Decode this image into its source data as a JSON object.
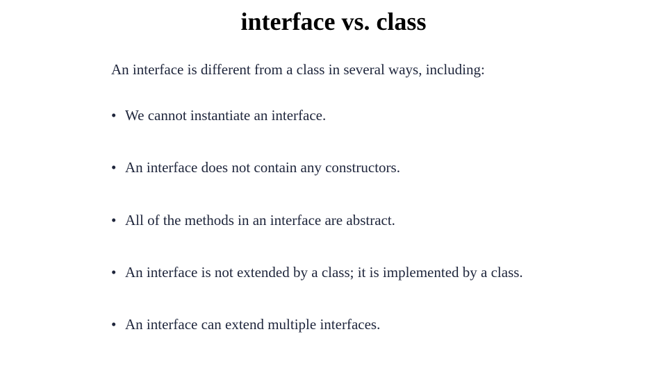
{
  "title": "interface vs. class",
  "intro": "An interface is different from a class in several ways, including:",
  "bullets": [
    "We cannot instantiate an interface.",
    "An interface does not contain any constructors.",
    "All of the methods in an interface are abstract.",
    "An interface is not extended by a class; it is implemented by a class.",
    "An interface can extend multiple interfaces."
  ]
}
